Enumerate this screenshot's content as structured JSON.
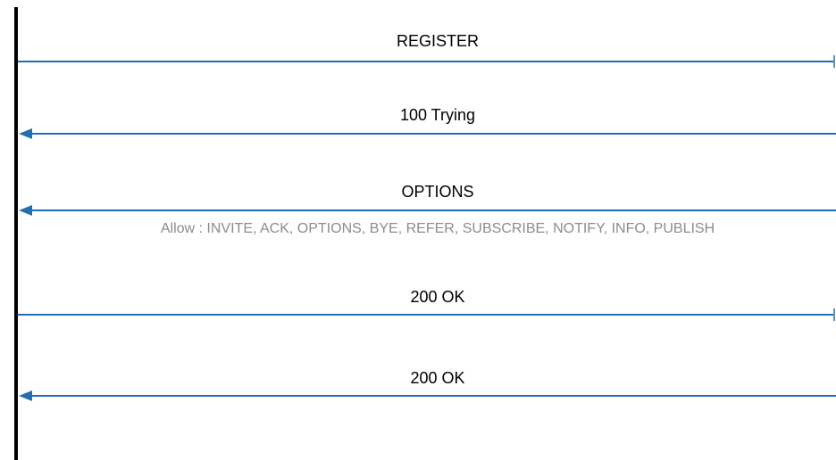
{
  "colors": {
    "lifeline": "#000000",
    "arrow": "#1f6fb4",
    "label": "#000000",
    "detail": "#8c8c8c"
  },
  "messages": [
    {
      "label": "REGISTER",
      "direction": "outgoing"
    },
    {
      "label": "100 Trying",
      "direction": "incoming"
    },
    {
      "label": "OPTIONS",
      "direction": "incoming",
      "detail": "Allow : INVITE, ACK, OPTIONS, BYE, REFER, SUBSCRIBE, NOTIFY, INFO, PUBLISH"
    },
    {
      "label": "200 OK",
      "direction": "outgoing"
    },
    {
      "label": "200 OK",
      "direction": "incoming"
    }
  ]
}
